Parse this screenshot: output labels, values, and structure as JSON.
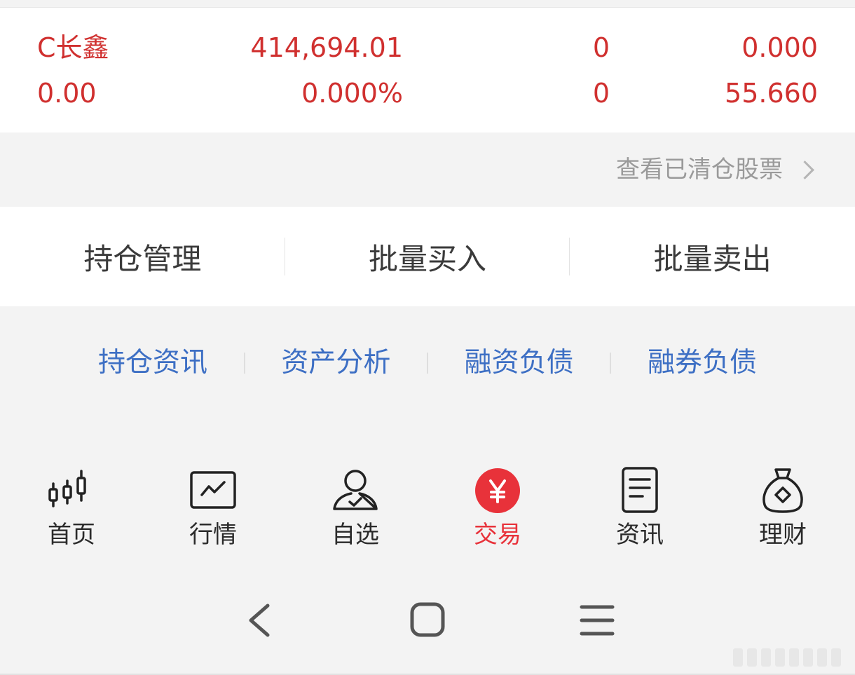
{
  "position": {
    "name": "C长鑫",
    "market_value": "414,694.01",
    "quantity": "0",
    "current_price": "0.000",
    "profit_loss": "0.00",
    "profit_loss_pct": "0.000%",
    "available": "0",
    "cost_price": "55.660"
  },
  "cleared_link": "查看已清仓股票",
  "actions": [
    "持仓管理",
    "批量买入",
    "批量卖出"
  ],
  "info_links": [
    "持仓资讯",
    "资产分析",
    "融资负债",
    "融券负债"
  ],
  "tabs": [
    {
      "label": "首页",
      "icon": "candlestick-icon"
    },
    {
      "label": "行情",
      "icon": "trend-chart-icon"
    },
    {
      "label": "自选",
      "icon": "user-check-icon"
    },
    {
      "label": "交易",
      "icon": "yuan-icon",
      "active": true
    },
    {
      "label": "资讯",
      "icon": "document-icon"
    },
    {
      "label": "理财",
      "icon": "money-bag-icon"
    }
  ],
  "system_nav": [
    "back-icon",
    "home-icon",
    "menu-icon"
  ],
  "colors": {
    "accent_red": "#e8323a",
    "value_red": "#d0302f",
    "link_blue": "#3d6fc4",
    "muted_gray": "#9a9a9a",
    "background": "#f3f3f3"
  }
}
